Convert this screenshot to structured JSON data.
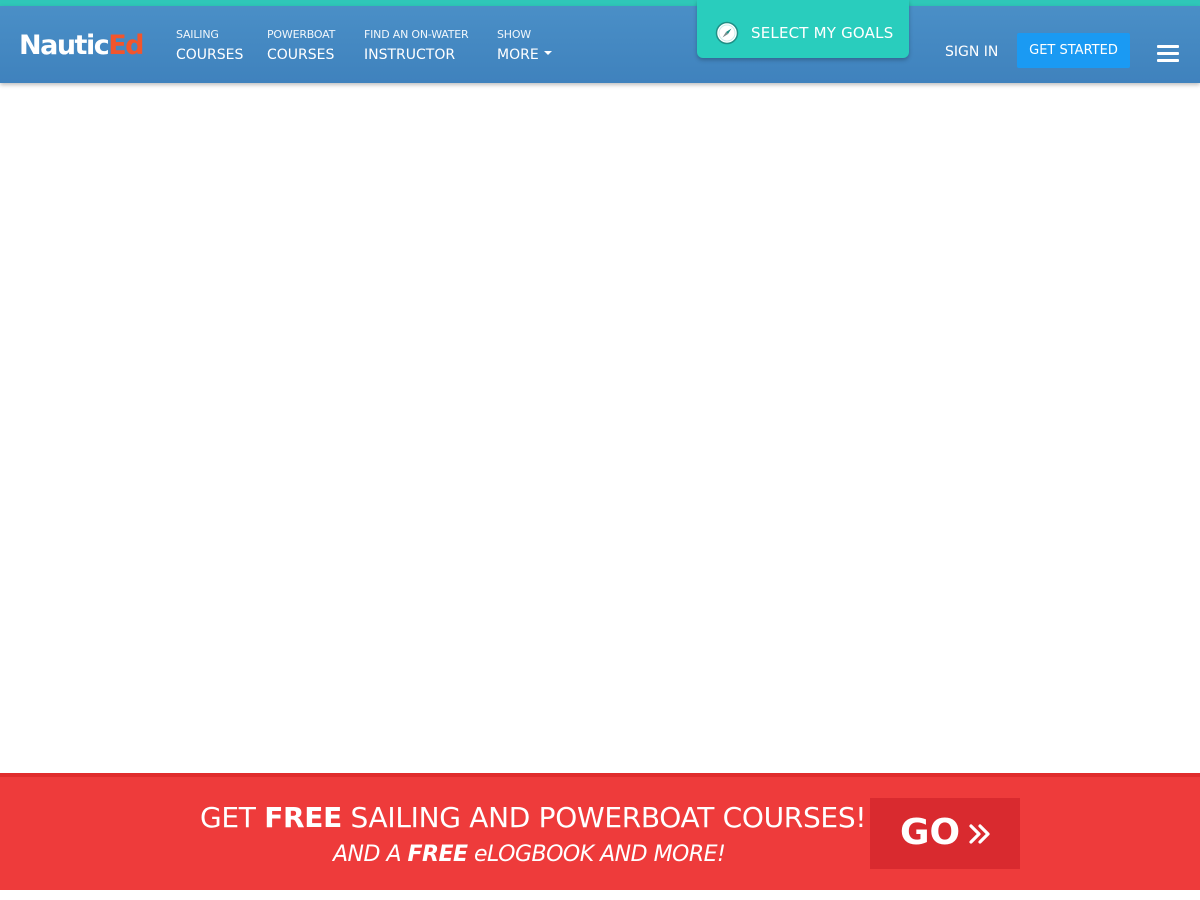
{
  "brand": {
    "logo_part1": "Nautic",
    "logo_part2": "Ed",
    "primary_color": "#3f82bd",
    "accent_color": "#f2552c",
    "teal_color": "#29cdbd"
  },
  "nav": {
    "items": [
      {
        "small": "SAILING",
        "big": "COURSES"
      },
      {
        "small": "POWERBOAT",
        "big": "COURSES"
      },
      {
        "small": "FIND AN ON-WATER",
        "big": "INSTRUCTOR"
      },
      {
        "small": "SHOW",
        "big": "MORE"
      }
    ],
    "goals_label": "SELECT MY GOALS",
    "goals_icon": "compass-icon",
    "sign_in": "SIGN IN",
    "get_started": "GET STARTED",
    "menu_icon": "hamburger-menu-icon"
  },
  "banner": {
    "line1_pre": "GET ",
    "line1_bold": "FREE",
    "line1_post": " SAILING AND POWERBOAT COURSES!",
    "line2_pre": "AND A ",
    "line2_bold": "FREE",
    "line2_post": " eLOGBOOK AND MORE!",
    "go_label": "GO",
    "go_icon": "double-chevron-right-icon",
    "color": "#ee3b3b"
  }
}
